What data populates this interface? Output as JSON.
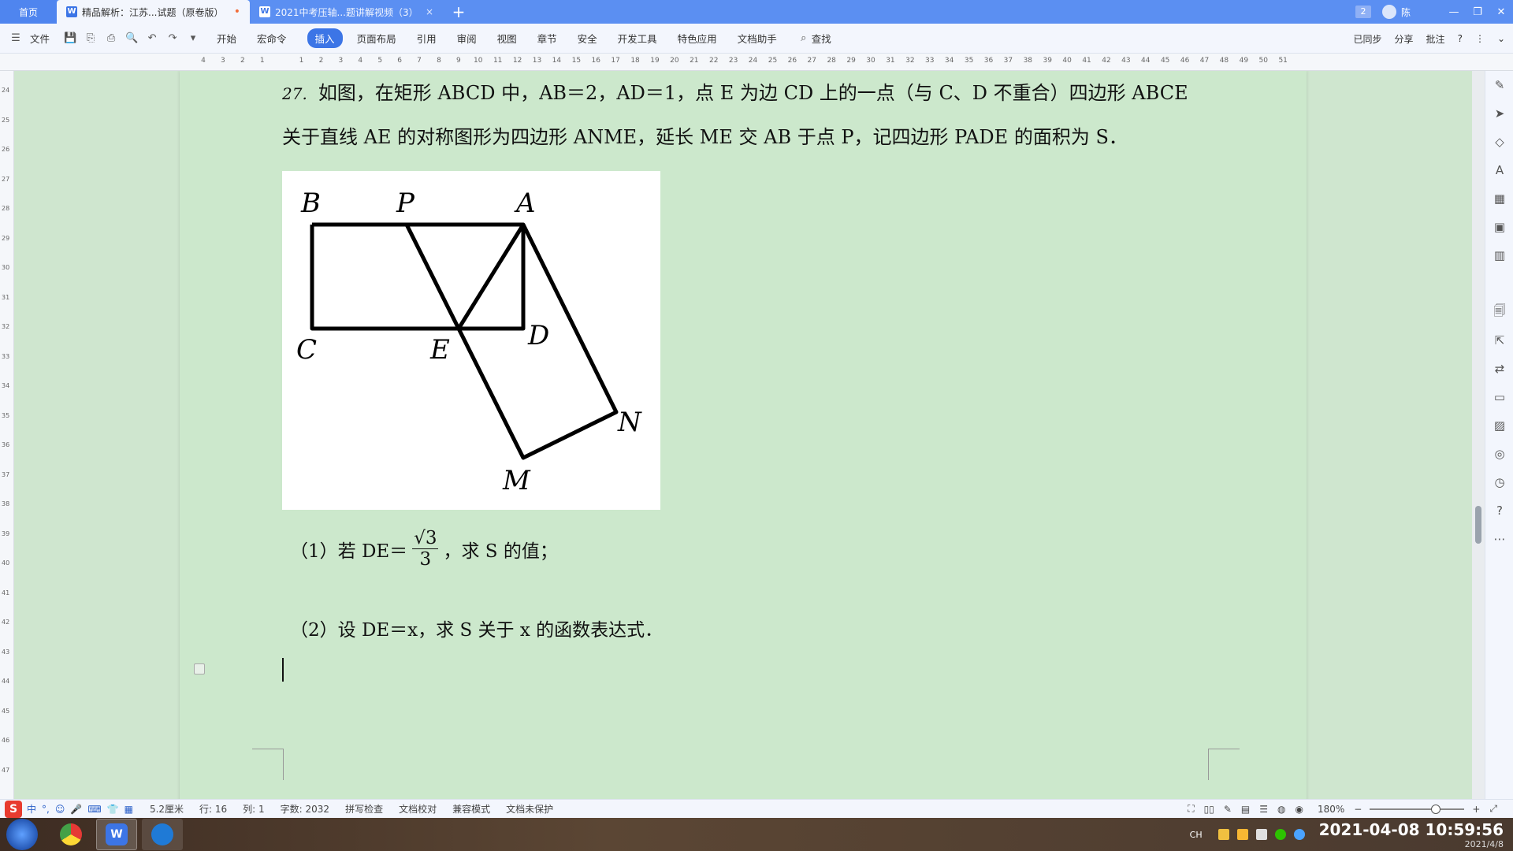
{
  "tabs": {
    "home": "首页",
    "active": {
      "label": "精品解析：江苏...试题（原卷版）",
      "unsaved_marker": "•"
    },
    "inactive": {
      "label": "2021中考压轴...题讲解视频（3）",
      "close": "×"
    },
    "new_tab": "+"
  },
  "title_right": {
    "badge": "2",
    "user": "陈",
    "minimize": "—",
    "restore": "❐",
    "close": "✕"
  },
  "toolbar": {
    "file": "文件",
    "menus": [
      "开始",
      "宏命令",
      "插入",
      "页面布局",
      "引用",
      "审阅",
      "视图",
      "章节",
      "安全",
      "开发工具",
      "特色应用",
      "文档助手"
    ],
    "active_menu": "插入",
    "search": "查找",
    "synced": "已同步",
    "share": "分享",
    "comment": "批注",
    "help": "?"
  },
  "ruler_numbers": [
    "4",
    "3",
    "2",
    "1",
    "",
    "1",
    "2",
    "3",
    "4",
    "5",
    "6",
    "7",
    "8",
    "9",
    "10",
    "11",
    "12",
    "13",
    "14",
    "15",
    "16",
    "17",
    "18",
    "19",
    "20",
    "21",
    "22",
    "23",
    "24",
    "25",
    "26",
    "27",
    "28",
    "29",
    "30",
    "31",
    "32",
    "33",
    "34",
    "35",
    "36",
    "37",
    "38",
    "39",
    "40",
    "41",
    "42",
    "43",
    "44",
    "45",
    "46",
    "47",
    "48",
    "49",
    "50",
    "51"
  ],
  "vruler_numbers": [
    "24",
    "25",
    "26",
    "27",
    "28",
    "29",
    "30",
    "31",
    "32",
    "33",
    "34",
    "35",
    "36",
    "37",
    "38",
    "39",
    "40",
    "41",
    "42",
    "43",
    "44",
    "45",
    "46",
    "47"
  ],
  "document": {
    "problem_number": "27.",
    "line1": "如图，在矩形 ABCD 中，AB＝2，AD＝1，点 E 为边 CD 上的一点（与 C、D 不重合）四边形 ABCE",
    "line2": "关于直线 AE 的对称图形为四边形 ANME，延长 ME 交 AB 于点 P，记四边形 PADE 的面积为 S．",
    "figure_labels": {
      "B": "B",
      "P": "P",
      "A": "A",
      "C": "C",
      "E": "E",
      "D": "D",
      "N": "N",
      "M": "M"
    },
    "q1_prefix": "（1）若 DE＝",
    "q1_num": "√3",
    "q1_den": "3",
    "q1_suffix": "，求 S 的值；",
    "q2": "（2）设 DE＝x，求 S 关于 x 的函数表达式．"
  },
  "statusbar": {
    "ime_logo": "S",
    "ime_items": [
      "中",
      "°,",
      "☺",
      "🎤",
      "⌨",
      "👕",
      "▦"
    ],
    "position": "5.2厘米",
    "row": "行: 16",
    "col": "列: 1",
    "word_count": "字数: 2032",
    "spell_check": "拼写检查",
    "doc_check": "文档校对",
    "compat": "兼容模式",
    "protect": "文档未保护",
    "zoom": "180%"
  },
  "taskbar": {
    "lang": "CH",
    "time": "10:59:56",
    "date": "2021-04-08",
    "date_small": "2021/4/8"
  }
}
